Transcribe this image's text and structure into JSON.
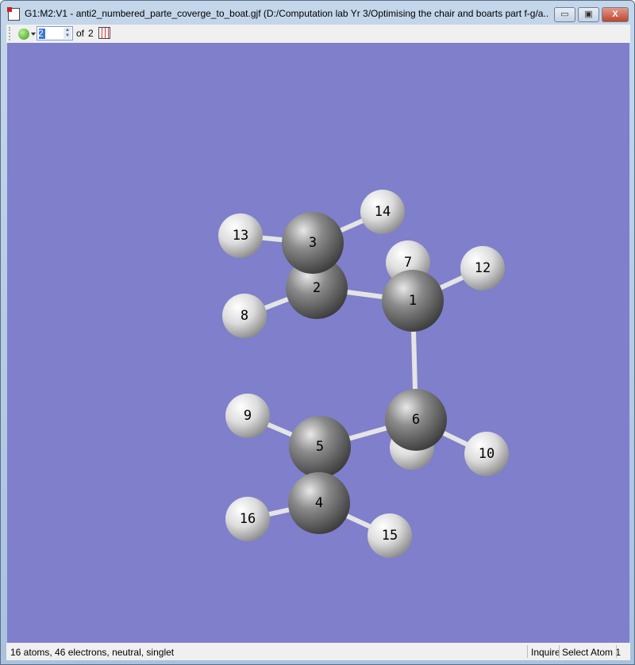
{
  "window": {
    "title": "G1:M2:V1 - anti2_numbered_parte_coverge_to_boat.gjf (D:/Computation lab Yr 3/Optimising the chair and boarts part f-g/a...",
    "minimize": "▭",
    "maximize": "▣",
    "close": "X"
  },
  "toolbar": {
    "frame_value": "2",
    "of_label": "of",
    "frame_total": "2",
    "icons": [
      "green-ball-icon",
      "calculator-icon"
    ]
  },
  "molecule": {
    "background": "#7f7fcc",
    "atoms": [
      {
        "label": "",
        "element": "H"
      },
      {
        "label": "7",
        "element": "H"
      },
      {
        "label": "2",
        "element": "C"
      },
      {
        "label": "3",
        "element": "C"
      },
      {
        "label": "13",
        "element": "H"
      },
      {
        "label": "14",
        "element": "H"
      },
      {
        "label": "1",
        "element": "C"
      },
      {
        "label": "12",
        "element": "H"
      },
      {
        "label": "8",
        "element": "H"
      },
      {
        "label": "6",
        "element": "C"
      },
      {
        "label": "9",
        "element": "H"
      },
      {
        "label": "10",
        "element": "H"
      },
      {
        "label": "5",
        "element": "C"
      },
      {
        "label": "4",
        "element": "C"
      },
      {
        "label": "16",
        "element": "H"
      },
      {
        "label": "15",
        "element": "H"
      }
    ],
    "bonds": [
      [
        "3",
        "13"
      ],
      [
        "3",
        "14"
      ],
      [
        "3",
        "2"
      ],
      [
        "2",
        "8"
      ],
      [
        "2",
        "1"
      ],
      [
        "1",
        "12"
      ],
      [
        "1",
        "7"
      ],
      [
        "1",
        "6"
      ],
      [
        "6",
        "5"
      ],
      [
        "6",
        "10"
      ],
      [
        "6",
        ""
      ],
      [
        "5",
        "9"
      ],
      [
        "5",
        "4",
        2
      ],
      [
        "4",
        "16"
      ],
      [
        "4",
        "15"
      ]
    ]
  },
  "status": {
    "text": "16 atoms, 46 electrons, neutral, singlet",
    "mode": "Inquire",
    "action": "Select Atom 1"
  }
}
